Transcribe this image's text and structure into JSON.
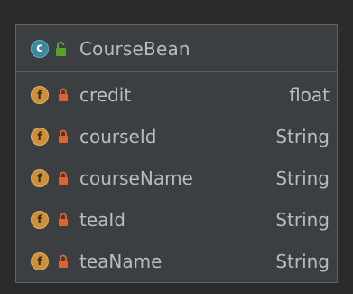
{
  "class_card": {
    "class_badge_letter": "c",
    "title": "CourseBean",
    "visibility_icon": "unlock-icon",
    "fields": [
      {
        "badge_letter": "f",
        "access_icon": "lock-icon",
        "name": "credit",
        "type": "float"
      },
      {
        "badge_letter": "f",
        "access_icon": "lock-icon",
        "name": "courseId",
        "type": "String"
      },
      {
        "badge_letter": "f",
        "access_icon": "lock-icon",
        "name": "courseName",
        "type": "String"
      },
      {
        "badge_letter": "f",
        "access_icon": "lock-icon",
        "name": "teaId",
        "type": "String"
      },
      {
        "badge_letter": "f",
        "access_icon": "lock-icon",
        "name": "teaName",
        "type": "String"
      }
    ]
  },
  "colors": {
    "background": "#2b2b2b",
    "card": "#3c3f41",
    "text": "#bbbbbb",
    "class_badge": "#3e86a0",
    "field_badge": "#cc8f3a",
    "lock": "#e0622c",
    "unlock": "#5aa02c"
  }
}
